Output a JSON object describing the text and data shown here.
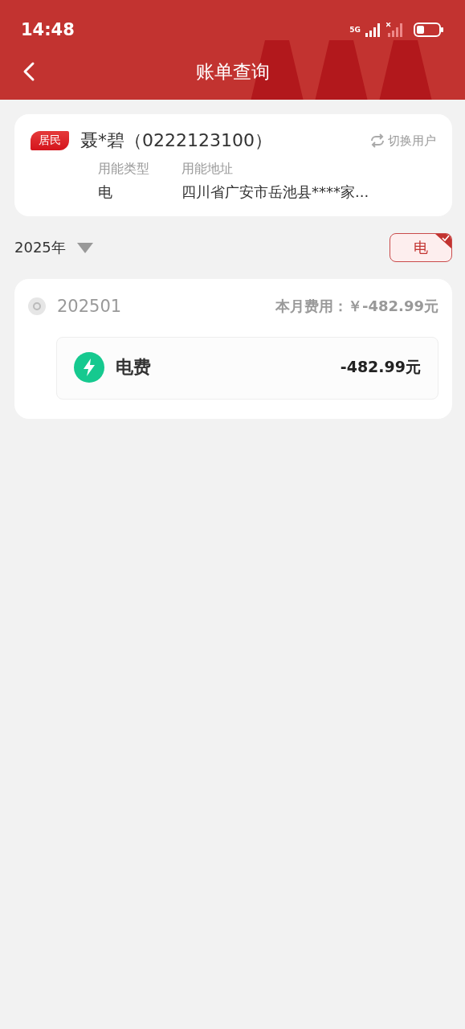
{
  "status_bar": {
    "time": "14:48",
    "network": "5G"
  },
  "header": {
    "title": "账单查询"
  },
  "user_card": {
    "tag": "居民",
    "name": "聂*碧（0222123100）",
    "switch_label": "切换用户",
    "fields": [
      {
        "label": "用能类型",
        "value": "电"
      },
      {
        "label": "用能地址",
        "value": "四川省广安市岳池县****家..."
      }
    ]
  },
  "filter": {
    "year": "2025年",
    "types": [
      {
        "label": "电",
        "selected": true
      }
    ]
  },
  "bills": [
    {
      "month": "202501",
      "total": "本月费用：￥-482.99元",
      "items": [
        {
          "kind": "electricity",
          "name": "电费",
          "amount": "-482.99元"
        }
      ]
    }
  ]
}
